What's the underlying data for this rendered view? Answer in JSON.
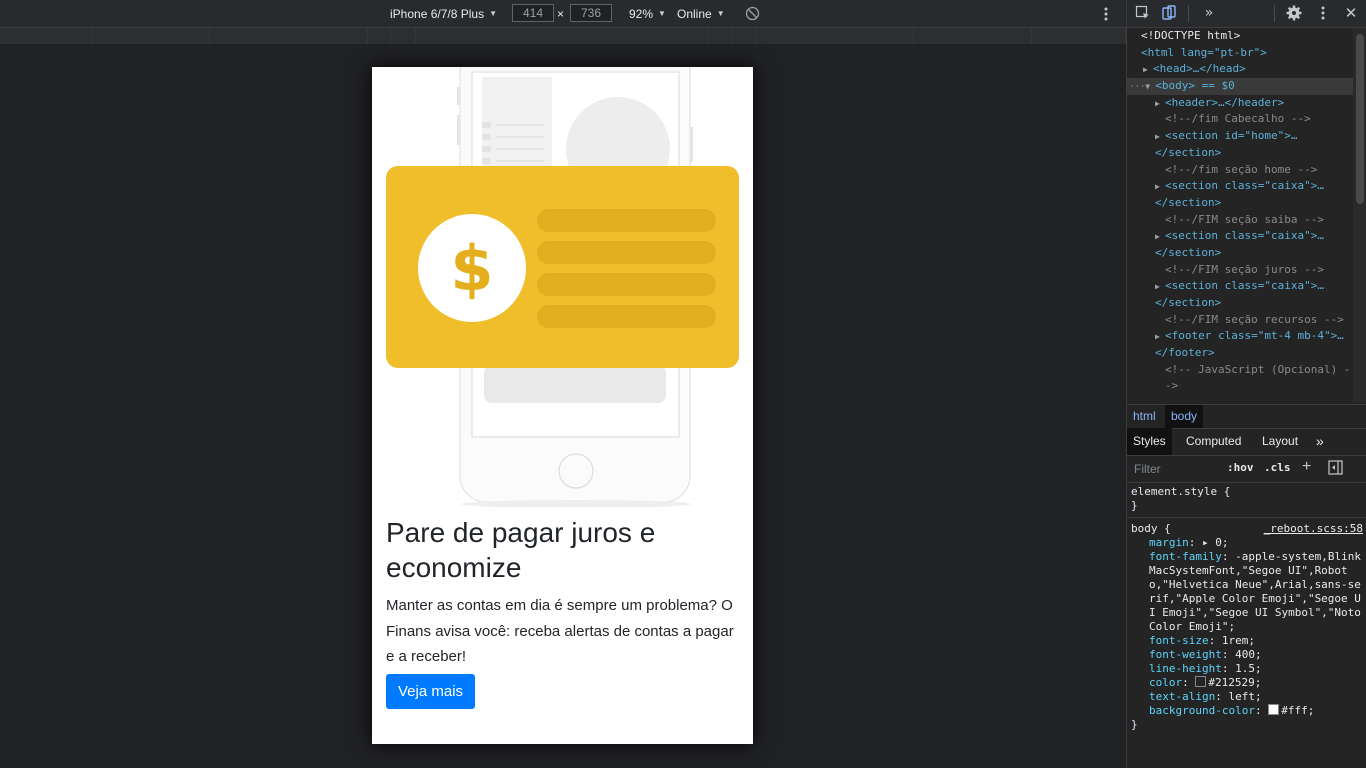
{
  "toolbar": {
    "device": "iPhone 6/7/8 Plus",
    "width": "414",
    "times": "×",
    "height": "736",
    "zoom": "92%",
    "network": "Online"
  },
  "page": {
    "heading": "Pare de pagar juros e economize",
    "text": "Manter as contas em dia é sempre um problema? O Finans avisa você: receba alertas de contas a pagar e a receber!",
    "button": "Veja mais",
    "card_symbol": "$",
    "colors": {
      "card": "#f0bd2b",
      "card_lines": "#e0ae1f",
      "button": "#007bff"
    }
  },
  "devtools": {
    "tree": [
      {
        "text": "<!DOCTYPE html>"
      },
      {
        "text": "<html lang=\"pt-br\">"
      },
      {
        "text": "<head>…</head>"
      },
      {
        "text": "<body> == $0"
      },
      {
        "text": "<header>…</header>"
      },
      {
        "text": "<!--/fim Cabecalho -->"
      },
      {
        "text": "<section id=\"home\">…"
      },
      {
        "text": "</section>"
      },
      {
        "text": "<!--/fim seção home -->"
      },
      {
        "text": "<section class=\"caixa\">…"
      },
      {
        "text": "</section>"
      },
      {
        "text": "<!--/FIM seção saiba -->"
      },
      {
        "text": "<section class=\"caixa\">…"
      },
      {
        "text": "</section>"
      },
      {
        "text": "<!--/FIM seção juros -->"
      },
      {
        "text": "<section class=\"caixa\">…"
      },
      {
        "text": "</section>"
      },
      {
        "text": "<!--/FIM seção recursos -->"
      },
      {
        "text": "<footer class=\"mt-4 mb-4\">…"
      },
      {
        "text": "</footer>"
      },
      {
        "text": "<!-- JavaScript (Opcional) -"
      },
      {
        "text": "->"
      }
    ],
    "breadcrumbs": [
      "html",
      "body"
    ],
    "tabs": [
      "Styles",
      "Computed",
      "Layout",
      "»"
    ],
    "filter_placeholder": "Filter",
    "hov": ":hov",
    "cls": ".cls",
    "element_style": "element.style {",
    "close_brace": "}",
    "rule_selector": "body {",
    "rule_source": "_reboot.scss:58",
    "declarations": [
      {
        "prop": "margin",
        "value": "▸ 0;"
      },
      {
        "prop": "font-family",
        "value": "-apple-system,BlinkMacSystemFont,\"Segoe UI\",Roboto,\"Helvetica Neue\",Arial,sans-serif,\"Apple Color Emoji\",\"Segoe UI Emoji\",\"Segoe UI Symbol\",\"Noto Color Emoji\";"
      },
      {
        "prop": "font-size",
        "value": "1rem;"
      },
      {
        "prop": "font-weight",
        "value": "400;"
      },
      {
        "prop": "line-height",
        "value": "1.5;"
      },
      {
        "prop": "color",
        "value": "#212529;"
      },
      {
        "prop": "text-align",
        "value": "left;"
      },
      {
        "prop": "background-color",
        "value": "#fff;"
      }
    ]
  }
}
